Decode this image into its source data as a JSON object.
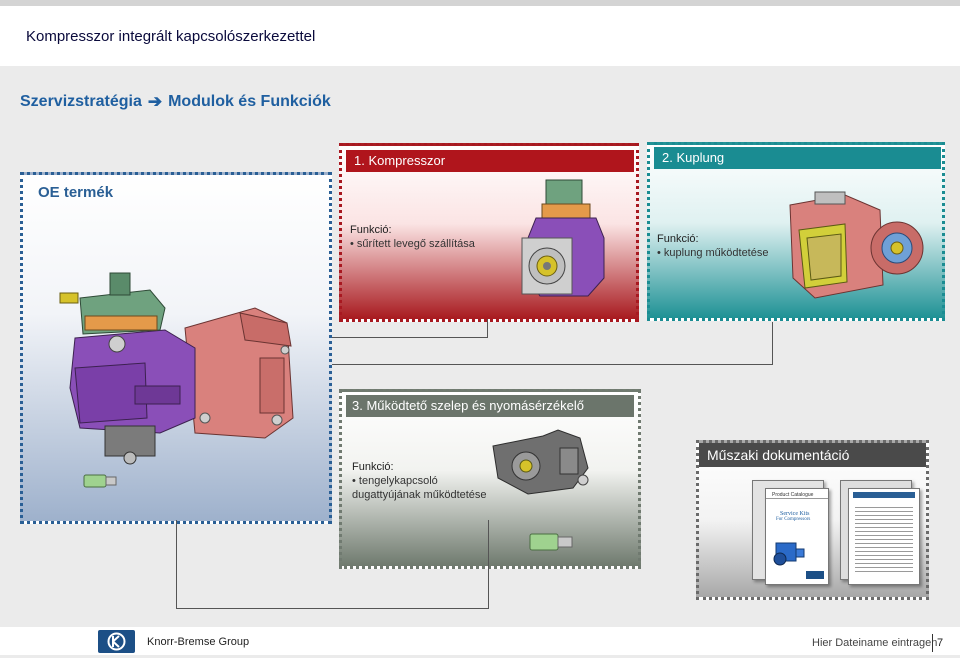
{
  "header": {
    "title": "Kompresszor integrált kapcsolószerkezettel",
    "subtitle_left": "Szervizstratégia",
    "subtitle_arrow": "➔",
    "subtitle_right": "Modulok és Funkciók"
  },
  "oe": {
    "label": "OE termék"
  },
  "modules": {
    "kompresszor": {
      "heading": "1. Kompresszor",
      "func_label": "Funkció:",
      "func_item": "• sűrített levegő szállítása",
      "color": "#b0151c"
    },
    "kuplung": {
      "heading": "2. Kuplung",
      "func_label": "Funkció:",
      "func_item": "• kuplung működtetése",
      "color": "#1a8c92"
    },
    "szelep": {
      "heading": "3. Működtető szelep és nyomásérzékelő",
      "func_label": "Funkció:",
      "func_item1": "• tengelykapcsoló",
      "func_item2": "dugattyújának működtetése",
      "color": "#6b756b"
    },
    "dokumentacio": {
      "heading": "Műszaki dokumentáció",
      "book1_line1": "Product Catalogue",
      "book1_line2": "Service Kits",
      "book1_line3": "For Compressors",
      "color": "#4a4a4a"
    }
  },
  "footer": {
    "company": "Knorr-Bremse Group",
    "file_name": "Hier Dateiname eintragen",
    "page": "7",
    "logo_icon": "knorr-bremse-logo-icon"
  }
}
